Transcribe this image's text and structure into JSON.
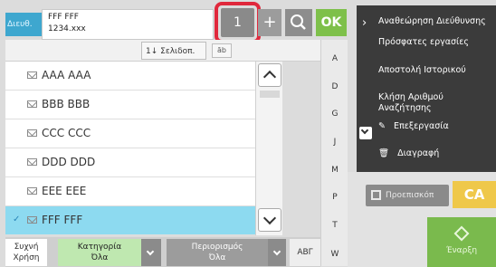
{
  "address": {
    "label": "Διευθ.",
    "name": "FFF FFF",
    "number": "1234.xxx"
  },
  "toolbar": {
    "count": "1",
    "plus": "+",
    "ok_label": "OK"
  },
  "sort": {
    "label": "Σελιδοπ.",
    "ab_label": "āb"
  },
  "list": [
    {
      "label": "AAA AAA",
      "selected": false
    },
    {
      "label": "BBB BBB",
      "selected": false
    },
    {
      "label": "CCC CCC",
      "selected": false
    },
    {
      "label": "DDD DDD",
      "selected": false
    },
    {
      "label": "EEE EEE",
      "selected": false
    },
    {
      "label": "FFF FFF",
      "selected": true
    }
  ],
  "index_letters": [
    "A",
    "D",
    "G",
    "J",
    "M",
    "P",
    "T",
    "W"
  ],
  "bottom_tabs": {
    "frequent": "Συχνή Χρήση",
    "category_title": "Κατηγορία",
    "category_value": "Όλα",
    "limit_title": "Περιορισμός",
    "limit_value": "Όλα",
    "abg": "ΑΒΓ"
  },
  "side_menu": {
    "review_address": "Αναθεώρηση Διεύθυνσης",
    "recent_jobs": "Πρόσφατες εργασίες",
    "send_history": "Αποστολή Ιστορικού",
    "call_search_number": "Κλήση Αριθμού Αναζήτησης",
    "edit": "Επεξεργασία",
    "delete": "Διαγραφή"
  },
  "actions": {
    "preview": "Προεπισκόπ",
    "ca": "CA",
    "start": "Έναρξη"
  },
  "colors": {
    "accent_blue": "#3ea7cf",
    "ok_green": "#7ec04a",
    "selected_row": "#8ddaf0",
    "highlight_ring": "#e0283c",
    "ca_yellow": "#efc84a"
  }
}
